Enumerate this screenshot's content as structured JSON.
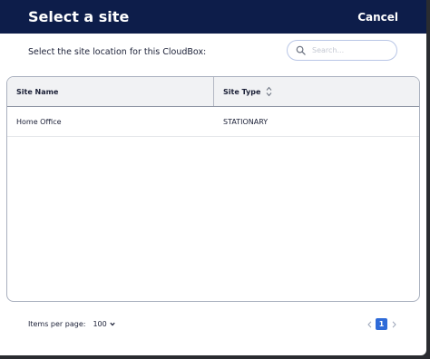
{
  "header": {
    "title": "Select a site",
    "cancel_label": "Cancel"
  },
  "subbar": {
    "instruction": "Select the site location for this CloudBox:",
    "search_placeholder": "Search...",
    "search_value": ""
  },
  "table": {
    "columns": [
      {
        "label": "Site Name",
        "sortable": false
      },
      {
        "label": "Site Type",
        "sortable": true
      }
    ],
    "rows": [
      {
        "site_name": "Home Office",
        "site_type": "STATIONARY"
      }
    ]
  },
  "footer": {
    "items_per_page_label": "Items per page:",
    "items_per_page_value": "100",
    "current_page": "1"
  },
  "colors": {
    "header_bg": "#0d1d4a",
    "accent": "#2f6bd8"
  },
  "icons": {
    "search": "search-icon",
    "sort": "sort-icon",
    "dropdown": "chevron-down-icon",
    "prev": "chevron-left-icon",
    "next": "chevron-right-icon"
  }
}
